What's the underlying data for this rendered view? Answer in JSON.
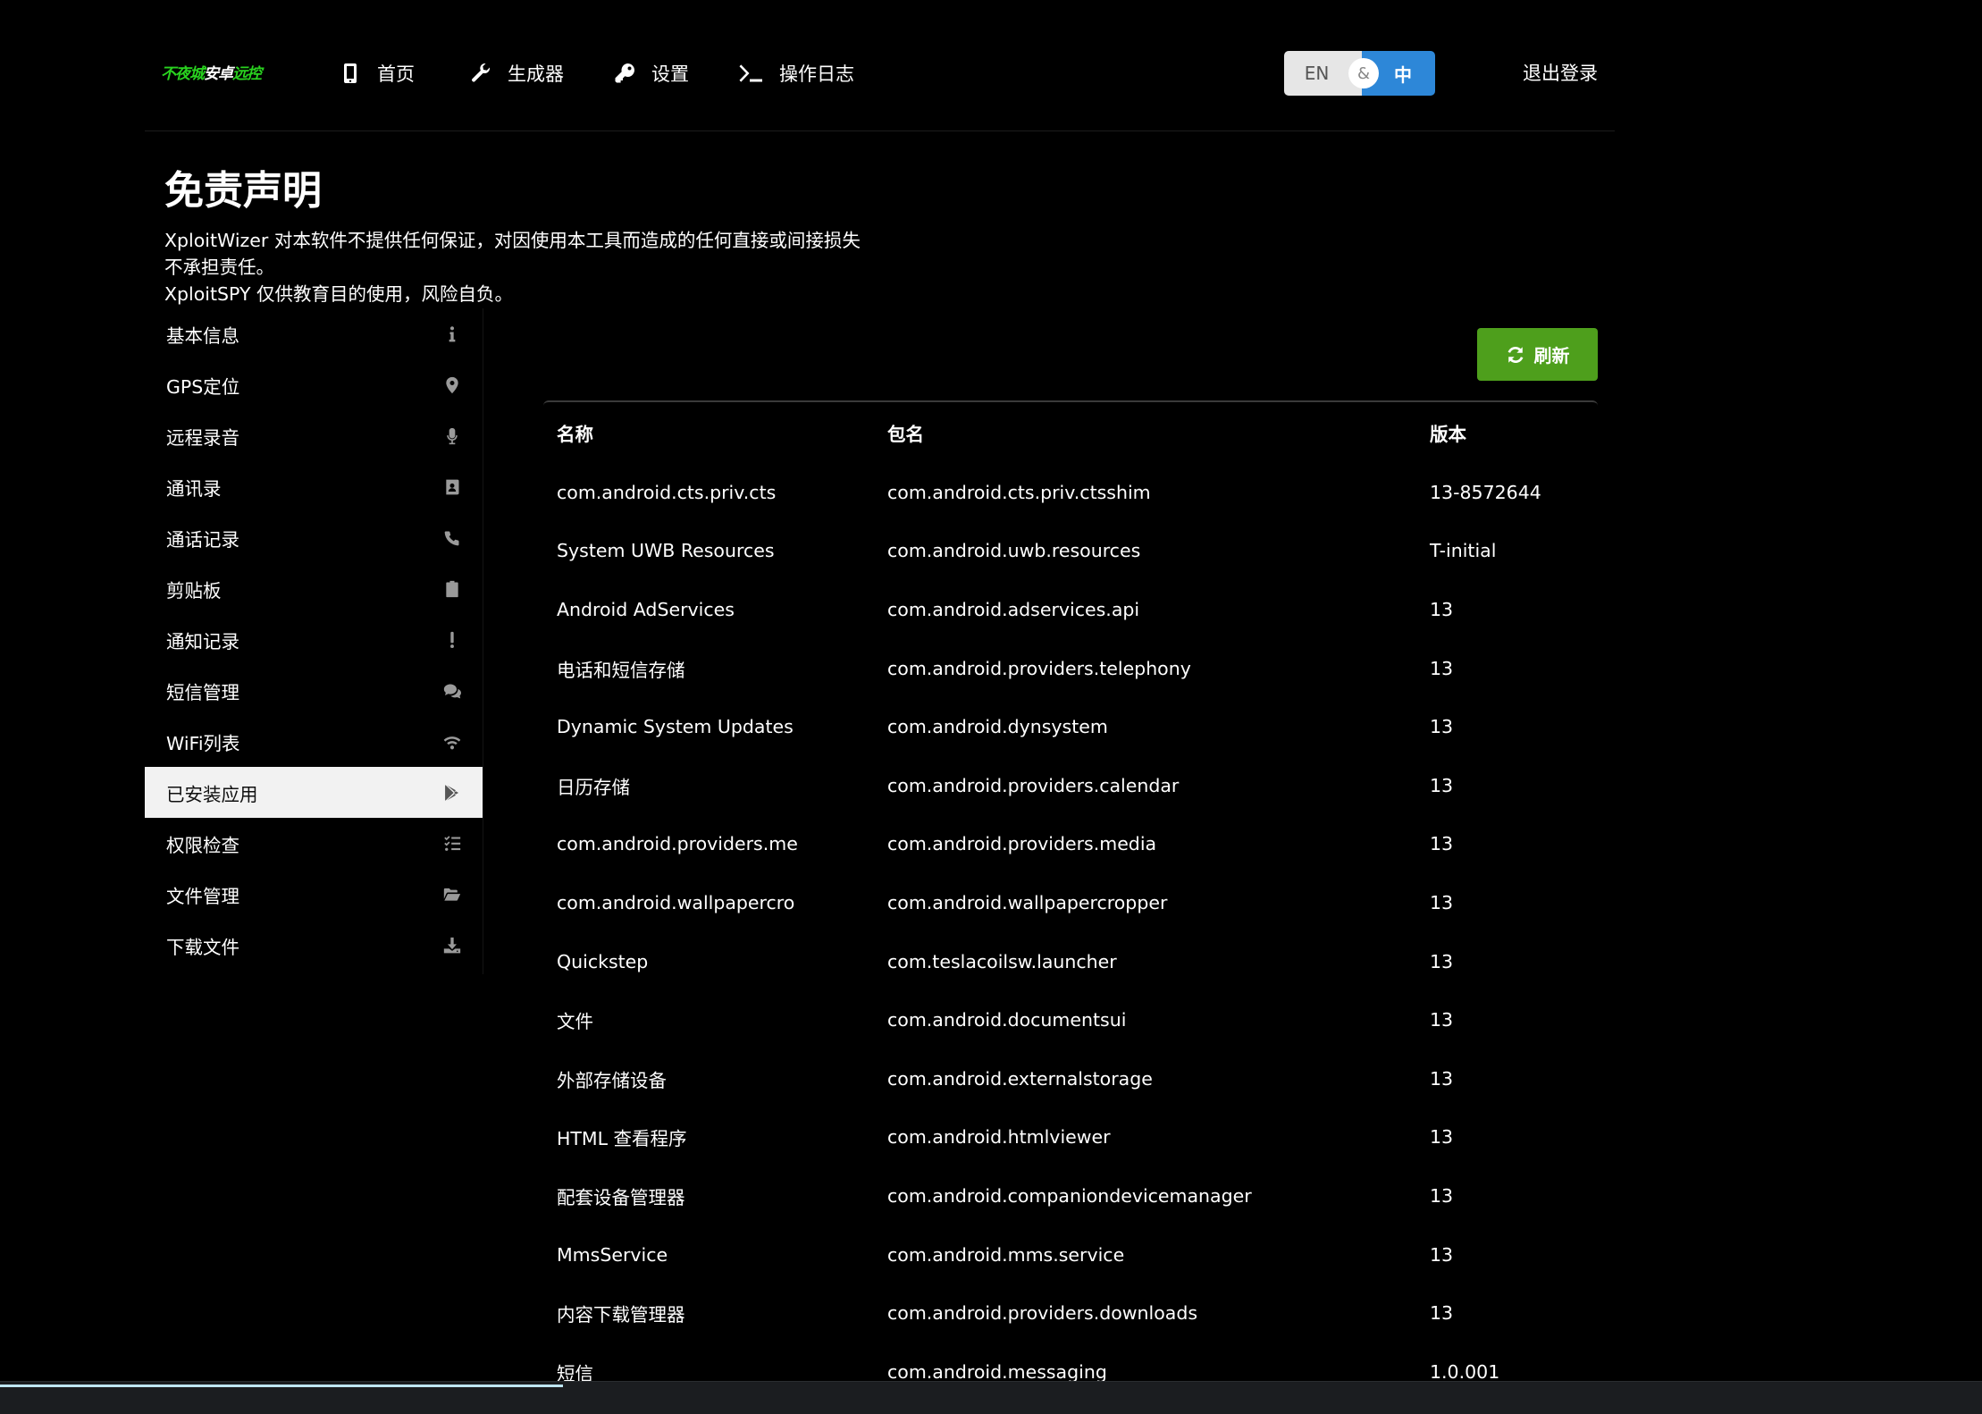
{
  "nav": {
    "logo_part1": "不夜城",
    "logo_part2": "安卓",
    "logo_part3": "远控",
    "items": [
      {
        "label": "首页",
        "icon": "mobile-icon"
      },
      {
        "label": "生成器",
        "icon": "wrench-icon"
      },
      {
        "label": "设置",
        "icon": "key-icon"
      },
      {
        "label": "操作日志",
        "icon": "terminal-icon"
      }
    ],
    "lang_en": "EN",
    "lang_amp": "&",
    "lang_zh": "中",
    "logout": "退出登录"
  },
  "disclaimer": {
    "title": "免责声明",
    "line1": "XploitWizer 对本软件不提供任何保证，对因使用本工具而造成的任何直接或间接损失不承担责任。",
    "line2": "XploitSPY 仅供教育目的使用，风险自负。"
  },
  "sidebar": {
    "items": [
      {
        "label": "基本信息",
        "icon": "info-icon"
      },
      {
        "label": "GPS定位",
        "icon": "map-marker-icon"
      },
      {
        "label": "远程录音",
        "icon": "microphone-icon"
      },
      {
        "label": "通讯录",
        "icon": "address-book-icon"
      },
      {
        "label": "通话记录",
        "icon": "phone-icon"
      },
      {
        "label": "剪贴板",
        "icon": "clipboard-icon"
      },
      {
        "label": "通知记录",
        "icon": "exclamation-icon"
      },
      {
        "label": "短信管理",
        "icon": "comments-icon"
      },
      {
        "label": "WiFi列表",
        "icon": "wifi-icon"
      },
      {
        "label": "已安装应用",
        "icon": "play-store-icon",
        "active": true
      },
      {
        "label": "权限检查",
        "icon": "tasks-icon"
      },
      {
        "label": "文件管理",
        "icon": "folder-open-icon"
      },
      {
        "label": "下载文件",
        "icon": "download-icon"
      }
    ]
  },
  "main": {
    "refresh_label": "刷新",
    "headers": [
      "名称",
      "包名",
      "版本"
    ],
    "rows": [
      [
        "com.android.cts.priv.cts",
        "com.android.cts.priv.ctsshim",
        "13-8572644"
      ],
      [
        "System UWB Resources",
        "com.android.uwb.resources",
        "T-initial"
      ],
      [
        "Android AdServices",
        "com.android.adservices.api",
        "13"
      ],
      [
        "电话和短信存储",
        "com.android.providers.telephony",
        "13"
      ],
      [
        "Dynamic System Updates",
        "com.android.dynsystem",
        "13"
      ],
      [
        "日历存储",
        "com.android.providers.calendar",
        "13"
      ],
      [
        "com.android.providers.me",
        "com.android.providers.media",
        "13"
      ],
      [
        "com.android.wallpapercro",
        "com.android.wallpapercropper",
        "13"
      ],
      [
        "Quickstep",
        "com.teslacoilsw.launcher",
        "13"
      ],
      [
        "文件",
        "com.android.documentsui",
        "13"
      ],
      [
        "外部存储设备",
        "com.android.externalstorage",
        "13"
      ],
      [
        "HTML 查看程序",
        "com.android.htmlviewer",
        "13"
      ],
      [
        "配套设备管理器",
        "com.android.companiondevicemanager",
        "13"
      ],
      [
        "MmsService",
        "com.android.mms.service",
        "13"
      ],
      [
        "内容下载管理器",
        "com.android.providers.downloads",
        "13"
      ],
      [
        "短信",
        "com.android.messaging",
        "1.0.001"
      ]
    ]
  },
  "colors": {
    "background": "#000000",
    "accent_green": "#4e9f1c",
    "accent_blue": "#2d87d8",
    "logo_green": "#29d21f"
  }
}
